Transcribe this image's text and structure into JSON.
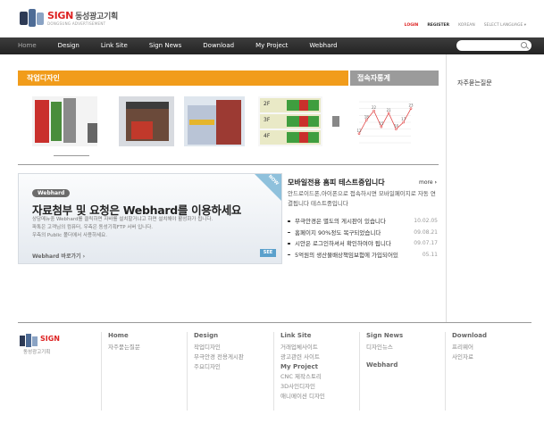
{
  "header": {
    "logo_name": "SIGN",
    "logo_name_ko": "동성광고기획",
    "logo_sub": "DONGSUNG ADVERTISEMENT",
    "toplinks": {
      "login": "LOGIN",
      "register": "REGISTER",
      "korean": "KOREAN",
      "language": "SELECT LANGUAGE ▾"
    }
  },
  "nav": {
    "items": [
      "Home",
      "Design",
      "Link Site",
      "Sign News",
      "Download",
      "My Project",
      "Webhard"
    ],
    "search_placeholder": ""
  },
  "sections": {
    "works_title": "작업디자인",
    "stats_title": "접속자통계"
  },
  "sidebar": {
    "faq": "자주묻는질문"
  },
  "thumbnails": {
    "floor_labels": [
      "2F",
      "3F",
      "4F"
    ]
  },
  "banner": {
    "badge": "Webhard",
    "title": "자료첨부 및 요청은 Webhard를 이용하세요",
    "desc": [
      "상담메뉴중 Webhard를 클릭하면 자바를 설치할거냐고 하면 설치해야 활성화가 됩니다.",
      "파톡은 고객님의 컴퓨터, 우측은 동성기획FTP 서버 입니다.",
      "우측의 Public 폴더에서 사용하세요."
    ],
    "link": "Webhard 바로가기 ›",
    "ribbon": "NOW",
    "corner_icon": "SEE"
  },
  "news": {
    "title": "모바일전용 홈피 테스트중입니다",
    "more": "more",
    "body": "안드로이드폰,아이폰으로 접속하시면 모바일페이지로 자동 연결됩니다 테스트중입니다",
    "items": [
      {
        "text": "무극안경은 별도의 게시판이 있습니다",
        "date": "10.02.05"
      },
      {
        "text": "홈페이지 90%정도 복구되었습니다",
        "date": "09.08.21"
      },
      {
        "text": "시안은 로그인하셔서 확인하여야 됩니다",
        "date": "09.07.17"
      },
      {
        "text": "5억원의 생산물배상책임보험에 가입되어있",
        "date": "05.11"
      }
    ]
  },
  "chart_data": {
    "type": "line",
    "values": [
      12,
      18,
      22,
      15,
      21,
      14,
      17,
      23
    ],
    "data_labels": [
      "12",
      "18",
      "22",
      "15",
      "21",
      "14",
      "17",
      "23"
    ],
    "color": "#e24a4a"
  },
  "footer": {
    "logo_name": "SIGN",
    "logo_sub": "동성광고기획",
    "columns": [
      {
        "head": "Home",
        "links": [
          "자주묻는질문"
        ]
      },
      {
        "head": "Design",
        "links": [
          "작업디자인",
          "무극안경 전용게시판",
          "주요디자인"
        ]
      },
      {
        "head": "Link Site",
        "links": [
          "거래업체사이트",
          "광고관련 사이트"
        ],
        "head2": "My Project",
        "links2": [
          "CNC 제작스토리",
          "3D사인디자인",
          "애니메이션 디자인"
        ]
      },
      {
        "head": "Sign News",
        "links": [
          "디자인뉴스"
        ],
        "head2": "Webhard",
        "links2": []
      },
      {
        "head": "Download",
        "links": [
          "프리웨어",
          "사인자료"
        ]
      }
    ]
  },
  "colors": {
    "accent_orange": "#f19c1b",
    "nav_dark": "#2e2e2e",
    "login_red": "#dd2222"
  }
}
